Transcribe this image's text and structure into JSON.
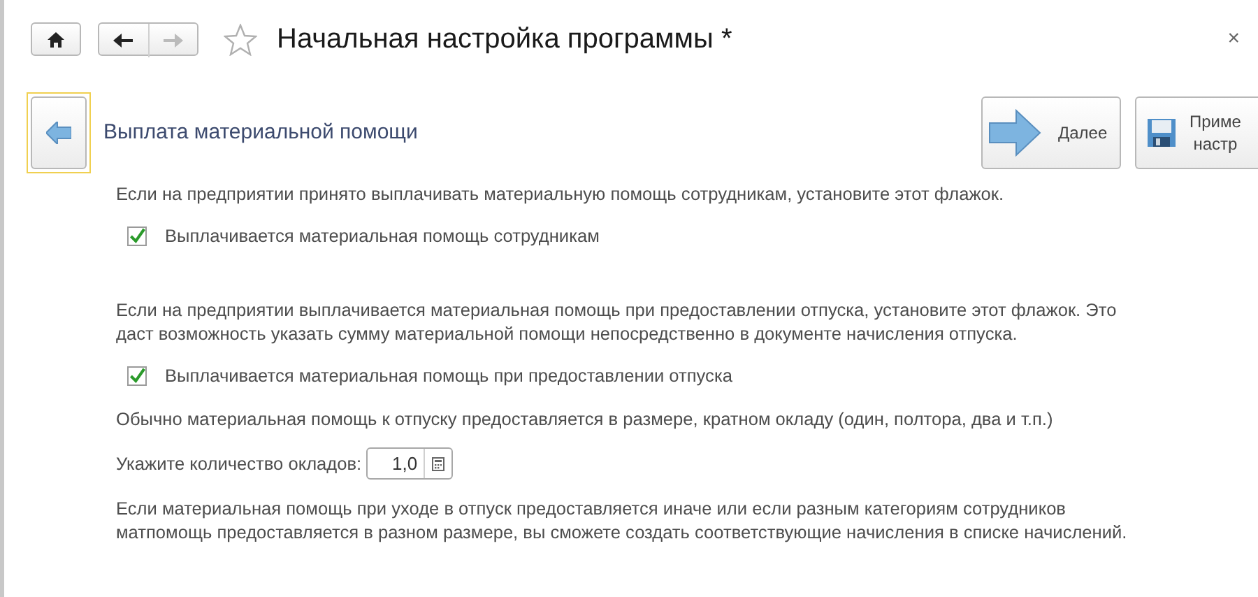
{
  "window": {
    "title": "Начальная настройка программы *",
    "close": "×"
  },
  "nav": {
    "back_disabled": false,
    "forward_disabled": true
  },
  "step": {
    "title": "Выплата материальной помощи"
  },
  "buttons": [
    {
      "kind": "next",
      "label": "Далее"
    },
    {
      "kind": "save",
      "lines": [
        "Приме",
        "настр"
      ]
    }
  ],
  "sections": [
    [
      {
        "kind": "text",
        "lines": [
          "Если на предприятии принято выплачивать материальную помощь сотрудникам, установите этот флажок."
        ]
      },
      {
        "kind": "checkbox",
        "label": "Выплачивается материальная помощь сотрудникам",
        "checked": true
      }
    ],
    [
      {
        "kind": "text",
        "lines": [
          "Если на предприятии выплачивается материальная помощь при предоставлении отпуска, установите этот флажок. Это",
          "даст возможность указать сумму материальной помощи непосредственно в документе начисления отпуска."
        ]
      },
      {
        "kind": "checkbox",
        "label": "Выплачивается материальная помощь при предоставлении отпуска",
        "checked": true
      },
      {
        "kind": "text",
        "lines": [
          "Обычно материальная помощь к отпуску предоставляется в размере, кратном окладу (один, полтора, два и т.п.)"
        ]
      },
      {
        "kind": "number",
        "label": "Укажите количество окладов:",
        "value": "1,0"
      },
      {
        "kind": "text",
        "lines": [
          "Если материальная помощь при уходе в отпуск предоставляется иначе или если разным категориям сотрудников",
          "матпомощь предоставляется в разном размере, вы сможете создать соответствующие начисления в списке начислений."
        ]
      }
    ]
  ]
}
